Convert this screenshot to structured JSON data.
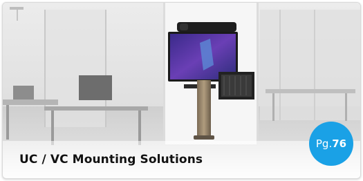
{
  "card": {
    "title": "UC / VC Mounting Solutions",
    "badge_prefix": "Pg.",
    "badge_number": "76",
    "accent_color": "#1aa1e6",
    "image_subject": "wall-mounted display with video conferencing camera and speaker bar on a pedestal stand in an office"
  }
}
